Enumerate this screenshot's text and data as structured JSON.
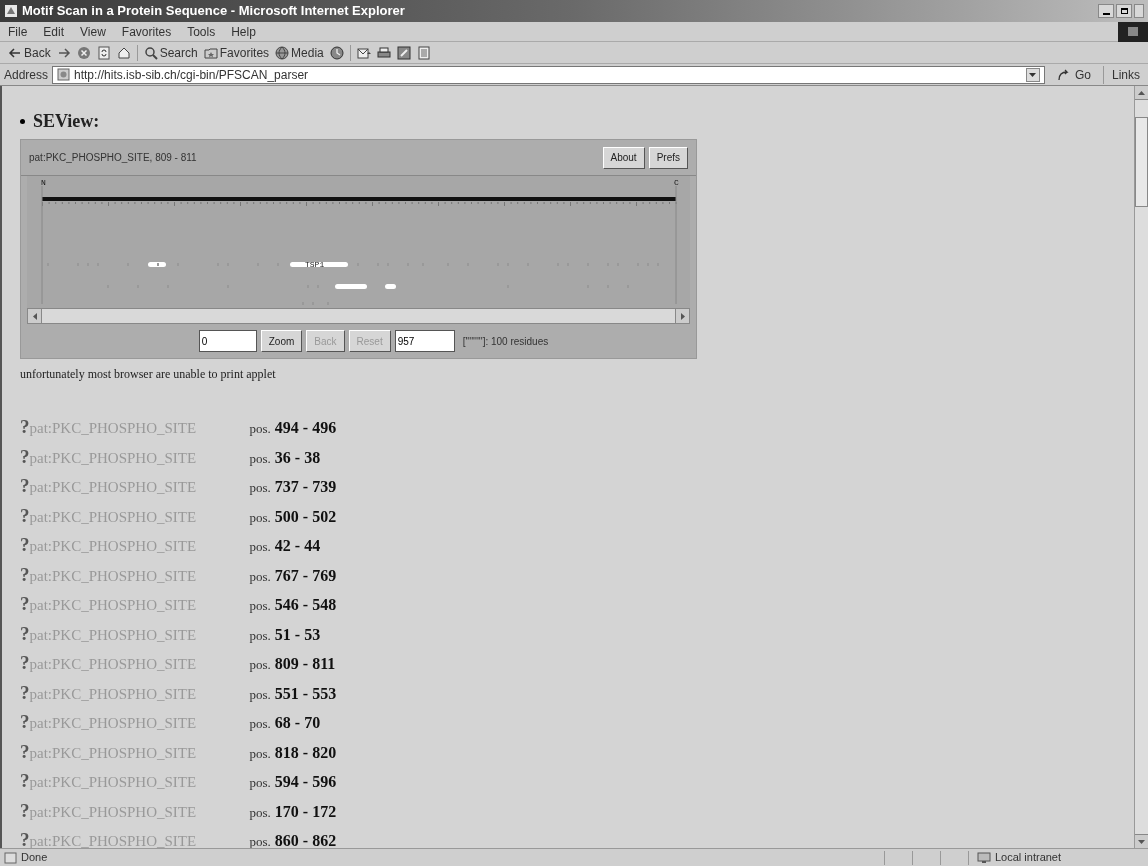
{
  "window": {
    "title": "Motif Scan in a Protein Sequence - Microsoft Internet Explorer"
  },
  "menu": [
    "File",
    "Edit",
    "View",
    "Favorites",
    "Tools",
    "Help"
  ],
  "toolbar": [
    {
      "kind": "back",
      "label": "Back"
    },
    {
      "kind": "forward"
    },
    {
      "kind": "stop"
    },
    {
      "kind": "refresh"
    },
    {
      "kind": "home"
    },
    {
      "kind": "search",
      "label": "Search"
    },
    {
      "kind": "favorites",
      "label": "Favorites"
    },
    {
      "kind": "media",
      "label": "Media"
    },
    {
      "kind": "history"
    },
    {
      "kind": "mail"
    },
    {
      "kind": "print"
    },
    {
      "kind": "edit"
    },
    {
      "kind": "discuss"
    }
  ],
  "address": {
    "label": "Address",
    "value": "http://hits.isb-sib.ch/cgi-bin/PFSCAN_parser",
    "go": "Go",
    "links": "Links"
  },
  "section_heading": "SEView:",
  "applet": {
    "title": "pat:PKC_PHOSPHO_SITE, 809 - 811",
    "buttons": [
      "About",
      "Prefs"
    ],
    "start_marker": "N",
    "end_marker": "C",
    "feature_label": "TSP1",
    "from": "0",
    "to": "957",
    "controls": [
      {
        "label": "Zoom",
        "disabled": false
      },
      {
        "label": "Back",
        "disabled": true
      },
      {
        "label": "Reset",
        "disabled": true
      }
    ],
    "scale_note": "[''''''''']: 100 residues"
  },
  "note": "unfortunately most browser are unable to print applet",
  "hits": [
    {
      "icon": "?",
      "pattern": "pat:PKC_PHOSPHO_SITE",
      "pos_label": "pos.",
      "range": "494 - 496"
    },
    {
      "icon": "?",
      "pattern": "pat:PKC_PHOSPHO_SITE",
      "pos_label": "pos.",
      "range": "36 - 38"
    },
    {
      "icon": "?",
      "pattern": "pat:PKC_PHOSPHO_SITE",
      "pos_label": "pos.",
      "range": "737 - 739"
    },
    {
      "icon": "?",
      "pattern": "pat:PKC_PHOSPHO_SITE",
      "pos_label": "pos.",
      "range": "500 - 502"
    },
    {
      "icon": "?",
      "pattern": "pat:PKC_PHOSPHO_SITE",
      "pos_label": "pos.",
      "range": "42 - 44"
    },
    {
      "icon": "?",
      "pattern": "pat:PKC_PHOSPHO_SITE",
      "pos_label": "pos.",
      "range": "767 - 769"
    },
    {
      "icon": "?",
      "pattern": "pat:PKC_PHOSPHO_SITE",
      "pos_label": "pos.",
      "range": "546 - 548"
    },
    {
      "icon": "?",
      "pattern": "pat:PKC_PHOSPHO_SITE",
      "pos_label": "pos.",
      "range": "51 - 53"
    },
    {
      "icon": "?",
      "pattern": "pat:PKC_PHOSPHO_SITE",
      "pos_label": "pos.",
      "range": "809 - 811"
    },
    {
      "icon": "?",
      "pattern": "pat:PKC_PHOSPHO_SITE",
      "pos_label": "pos.",
      "range": "551 - 553"
    },
    {
      "icon": "?",
      "pattern": "pat:PKC_PHOSPHO_SITE",
      "pos_label": "pos.",
      "range": "68 - 70"
    },
    {
      "icon": "?",
      "pattern": "pat:PKC_PHOSPHO_SITE",
      "pos_label": "pos.",
      "range": "818 - 820"
    },
    {
      "icon": "?",
      "pattern": "pat:PKC_PHOSPHO_SITE",
      "pos_label": "pos.",
      "range": "594 - 596"
    },
    {
      "icon": "?",
      "pattern": "pat:PKC_PHOSPHO_SITE",
      "pos_label": "pos.",
      "range": "170 - 172"
    },
    {
      "icon": "?",
      "pattern": "pat:PKC_PHOSPHO_SITE",
      "pos_label": "pos.",
      "range": "860 - 862"
    }
  ],
  "status_bar": {
    "text": "Done",
    "zone": "Local intranet"
  }
}
